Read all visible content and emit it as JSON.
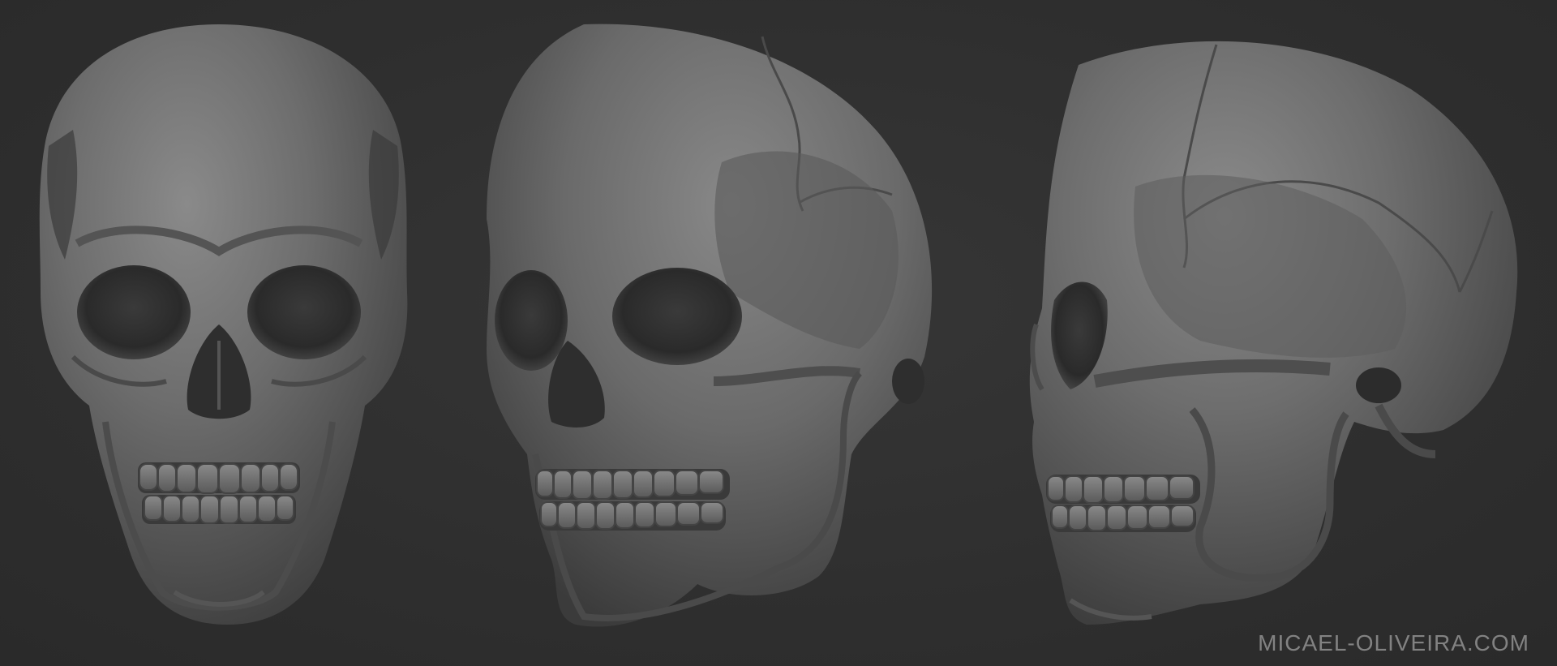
{
  "image": {
    "subject": "Three sculpted human skull renders: front view, three-quarter view, side view",
    "background_color": "#303030",
    "skull_color": "#6e6e6e",
    "views": [
      {
        "name": "front"
      },
      {
        "name": "three-quarter"
      },
      {
        "name": "side"
      }
    ]
  },
  "watermark": {
    "text": "MICAEL-OLIVEIRA.COM"
  }
}
